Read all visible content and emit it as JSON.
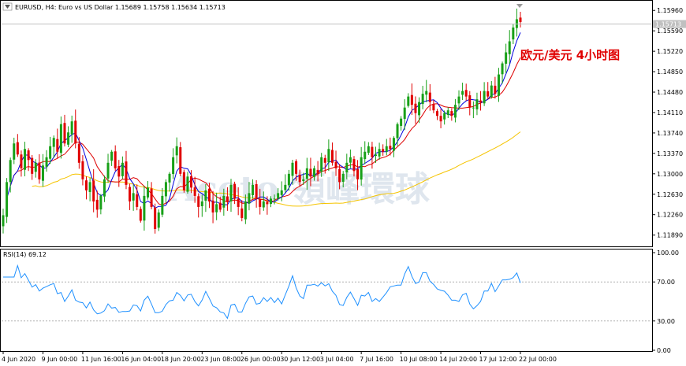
{
  "header": {
    "symbol_line": "EURUSD, H4:  Euro vs US Dollar  1.15689 1.15758 1.15634 1.15713",
    "caption": "欧元/美元 4小时图",
    "watermark": "Aceto 領峰環球"
  },
  "chart_data": [
    {
      "type": "candlestick",
      "symbol": "EURUSD",
      "timeframe": "H4",
      "title": "Euro vs US Dollar",
      "ohlc_last": {
        "open": 1.15689,
        "high": 1.15758,
        "low": 1.15634,
        "close": 1.15713
      },
      "price_label": "1.15713",
      "ylim": [
        1.117,
        1.1612
      ],
      "yticks": [
        "1.15960",
        "1.15590",
        "1.15220",
        "1.14850",
        "1.14480",
        "1.14110",
        "1.13740",
        "1.13370",
        "1.13000",
        "1.12630",
        "1.12260",
        "1.11890"
      ],
      "xticks": [
        "4 Jun 2020",
        "9 Jun 00:00",
        "11 Jun 16:00",
        "16 Jun 04:00",
        "18 Jun 20:00",
        "23 Jun 08:00",
        "26 Jun 00:00",
        "30 Jun 12:00",
        "3 Jul 04:00",
        "7 Jul 16:00",
        "10 Jul 08:00",
        "14 Jul 20:00",
        "17 Jul 12:00",
        "22 Jul 00:00"
      ],
      "closes": [
        1.1225,
        1.1285,
        1.1325,
        1.1355,
        1.1335,
        1.131,
        1.1345,
        1.1325,
        1.13,
        1.132,
        1.129,
        1.1315,
        1.133,
        1.135,
        1.1365,
        1.134,
        1.139,
        1.1355,
        1.1375,
        1.1395,
        1.1355,
        1.132,
        1.129,
        1.127,
        1.1285,
        1.125,
        1.1235,
        1.126,
        1.129,
        1.132,
        1.134,
        1.131,
        1.1295,
        1.132,
        1.128,
        1.125,
        1.1265,
        1.124,
        1.1215,
        1.126,
        1.1275,
        1.124,
        1.12,
        1.123,
        1.126,
        1.1285,
        1.13,
        1.133,
        1.135,
        1.13,
        1.127,
        1.1295,
        1.1275,
        1.126,
        1.124,
        1.125,
        1.127,
        1.125,
        1.123,
        1.1245,
        1.1235,
        1.126,
        1.125,
        1.128,
        1.1255,
        1.124,
        1.122,
        1.125,
        1.1265,
        1.128,
        1.1255,
        1.124,
        1.125,
        1.1245,
        1.1255,
        1.1255,
        1.1265,
        1.127,
        1.128,
        1.13,
        1.132,
        1.13,
        1.1285,
        1.129,
        1.131,
        1.1295,
        1.131,
        1.13,
        1.133,
        1.132,
        1.1345,
        1.132,
        1.131,
        1.1285,
        1.13,
        1.132,
        1.133,
        1.1305,
        1.129,
        1.133,
        1.134,
        1.135,
        1.133,
        1.1335,
        1.1345,
        1.134,
        1.135,
        1.1345,
        1.1365,
        1.139,
        1.14,
        1.142,
        1.144,
        1.1425,
        1.141,
        1.143,
        1.1445,
        1.145,
        1.143,
        1.1415,
        1.1405,
        1.1395,
        1.141,
        1.1415,
        1.1405,
        1.1425,
        1.144,
        1.145,
        1.144,
        1.142,
        1.142,
        1.1435,
        1.143,
        1.145,
        1.144,
        1.146,
        1.1445,
        1.148,
        1.15,
        1.152,
        1.154,
        1.1565,
        1.158,
        1.1575
      ],
      "rsi": {
        "label": "RSI(14) 69.12",
        "value": 69.12,
        "ylim": [
          0,
          100
        ],
        "yticks": [
          "100.00",
          "70.00",
          "30.00",
          "0.00"
        ],
        "levels": [
          70,
          30
        ]
      }
    }
  ]
}
